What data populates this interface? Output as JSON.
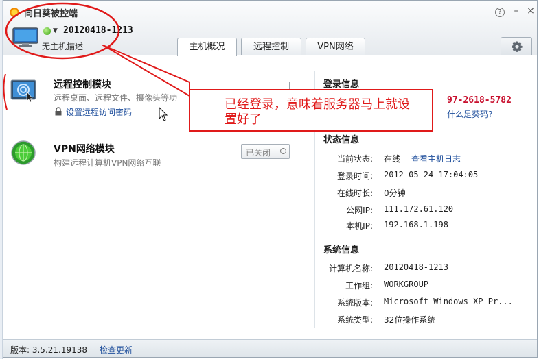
{
  "app": {
    "title": "向日葵被控端"
  },
  "host": {
    "name": "20120418-1213",
    "description": "无主机描述"
  },
  "tabs": [
    {
      "label": "主机概况"
    },
    {
      "label": "远程控制"
    },
    {
      "label": "VPN网络"
    }
  ],
  "icons": {
    "help": "question-icon",
    "minimize": "minimize-icon",
    "close": "close-icon",
    "settings": "gear-icon"
  },
  "modules": {
    "remote": {
      "title": "远程控制模块",
      "description": "远程桌面、远程文件、摄像头等功",
      "password_link": "设置远程访问密码"
    },
    "vpn": {
      "title": "VPN网络模块",
      "description": "构建远程计算机VPN网络互联",
      "toggle_label": "已关闭"
    }
  },
  "login": {
    "heading": "登录信息",
    "phone": "97-2618-5782",
    "help_link": "什么是葵码?"
  },
  "status": {
    "heading": "状态信息",
    "rows": [
      {
        "label": "当前状态:",
        "value": "在线"
      },
      {
        "label": "登录时间:",
        "value": "2012-05-24 17:04:05"
      },
      {
        "label": "在线时长:",
        "value": "0分钟"
      },
      {
        "label": "公网IP:",
        "value": "111.172.61.120"
      },
      {
        "label": "本机IP:",
        "value": "192.168.1.198"
      }
    ],
    "log_link": "查看主机日志"
  },
  "system": {
    "heading": "系统信息",
    "rows": [
      {
        "label": "计算机名称:",
        "value": "20120418-1213"
      },
      {
        "label": "工作组:",
        "value": "WORKGROUP"
      },
      {
        "label": "系统版本:",
        "value": "Microsoft Windows XP Pr..."
      },
      {
        "label": "系统类型:",
        "value": "32位操作系统"
      }
    ]
  },
  "footer": {
    "version": "版本: 3.5.21.19138",
    "check_update": "检查更新"
  },
  "annotation": {
    "text": "已经登录，意味着服务器马上就设置好了",
    "color": "#e01a1a"
  }
}
